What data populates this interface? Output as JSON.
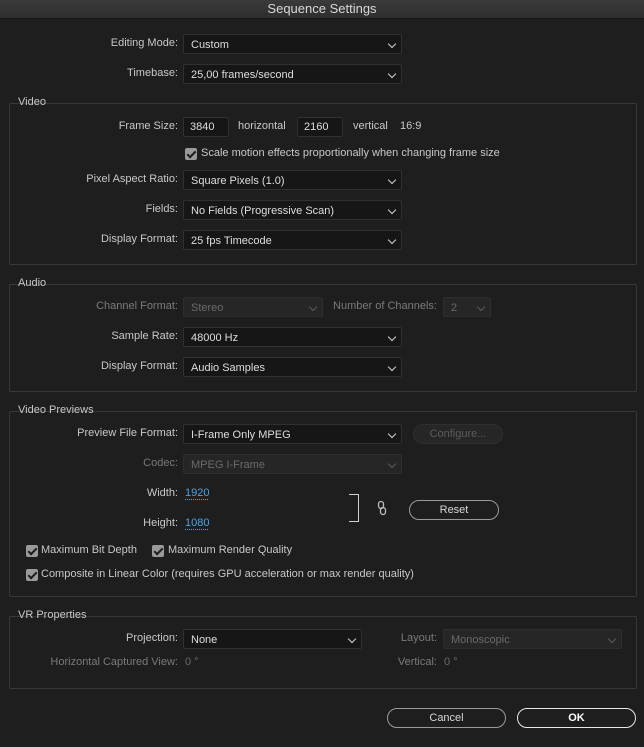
{
  "window": {
    "title": "Sequence Settings"
  },
  "general": {
    "editing_mode": {
      "label": "Editing Mode:",
      "value": "Custom"
    },
    "timebase": {
      "label": "Timebase:",
      "value": "25,00  frames/second"
    }
  },
  "video": {
    "title": "Video",
    "frame_size_label": "Frame Size:",
    "frame_width": "3840",
    "horizontal_label": "horizontal",
    "frame_height": "2160",
    "vertical_label": "vertical",
    "aspect": "16:9",
    "scale_motion_label": "Scale motion effects proportionally when changing frame size",
    "pixel_aspect": {
      "label": "Pixel Aspect Ratio:",
      "value": "Square Pixels (1.0)"
    },
    "fields": {
      "label": "Fields:",
      "value": "No Fields (Progressive Scan)"
    },
    "display_format": {
      "label": "Display Format:",
      "value": "25 fps Timecode"
    }
  },
  "audio": {
    "title": "Audio",
    "channel_format": {
      "label": "Channel Format:",
      "value": "Stereo"
    },
    "num_channels": {
      "label": "Number of Channels:",
      "value": "2"
    },
    "sample_rate": {
      "label": "Sample Rate:",
      "value": "48000 Hz"
    },
    "display_format": {
      "label": "Display Format:",
      "value": "Audio Samples"
    }
  },
  "previews": {
    "title": "Video Previews",
    "file_format": {
      "label": "Preview File Format:",
      "value": "I-Frame Only MPEG"
    },
    "configure_label": "Configure...",
    "codec": {
      "label": "Codec:",
      "value": "MPEG I-Frame"
    },
    "width": {
      "label": "Width:",
      "value": "1920"
    },
    "height": {
      "label": "Height:",
      "value": "1080"
    },
    "reset_label": "Reset",
    "max_bit_depth_label": "Maximum Bit Depth",
    "max_render_quality_label": "Maximum Render Quality",
    "composite_linear_label": "Composite in Linear Color (requires GPU acceleration or max render quality)"
  },
  "vr": {
    "title": "VR Properties",
    "projection": {
      "label": "Projection:",
      "value": "None"
    },
    "layout": {
      "label": "Layout:",
      "value": "Monoscopic"
    },
    "horizontal_view": {
      "label": "Horizontal Captured View:",
      "value": "0 °"
    },
    "vertical": {
      "label": "Vertical:",
      "value": "0 °"
    }
  },
  "footer": {
    "cancel_label": "Cancel",
    "ok_label": "OK"
  }
}
